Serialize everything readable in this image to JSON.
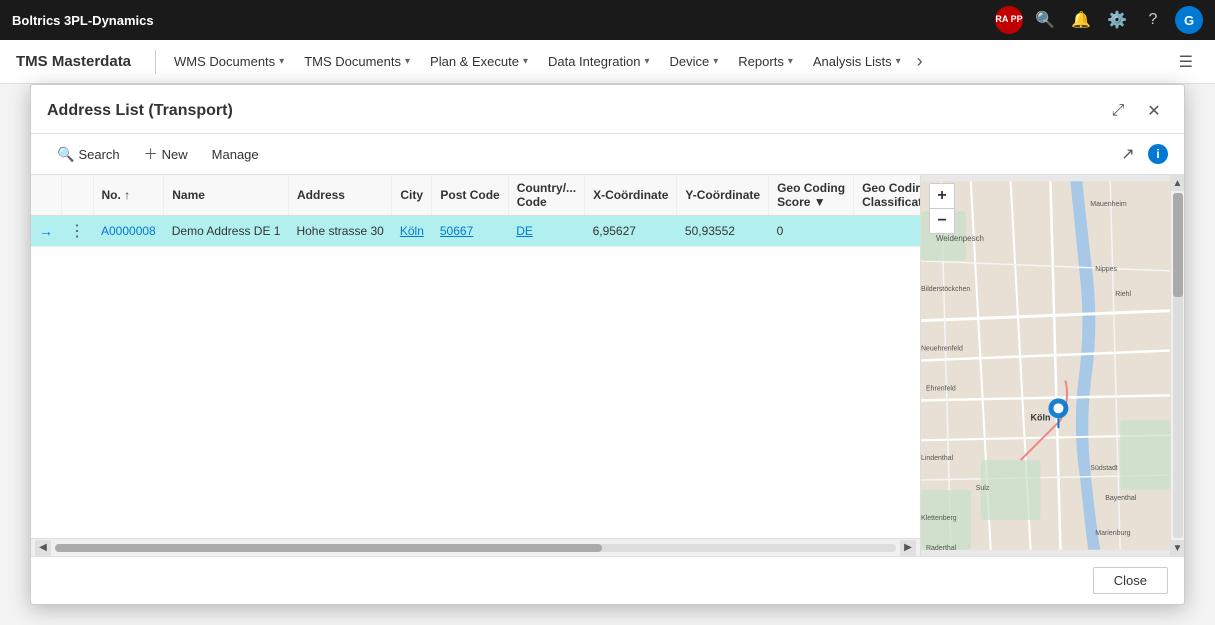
{
  "app": {
    "title": "Boltrics 3PL-Dynamics",
    "avatar_badge": "RA PP",
    "user_initial": "G"
  },
  "second_bar": {
    "title": "TMS Masterdata",
    "nav_items": [
      {
        "label": "WMS Documents",
        "has_chevron": true
      },
      {
        "label": "TMS Documents",
        "has_chevron": true
      },
      {
        "label": "Plan & Execute",
        "has_chevron": true
      },
      {
        "label": "Data Integration",
        "has_chevron": true
      },
      {
        "label": "Device",
        "has_chevron": true
      },
      {
        "label": "Reports",
        "has_chevron": true
      },
      {
        "label": "Analysis Lists",
        "has_chevron": true
      }
    ]
  },
  "modal": {
    "title": "Address List (Transport)",
    "toolbar": {
      "search_label": "Search",
      "new_label": "New",
      "manage_label": "Manage"
    },
    "table": {
      "columns": [
        {
          "label": "No. ↑",
          "key": "no",
          "sortable": true
        },
        {
          "label": "Name",
          "key": "name"
        },
        {
          "label": "Address",
          "key": "address"
        },
        {
          "label": "City",
          "key": "city"
        },
        {
          "label": "Post Code",
          "key": "post_code"
        },
        {
          "label": "Country/... Code",
          "key": "country_code"
        },
        {
          "label": "X-Coördinate",
          "key": "x_coord"
        },
        {
          "label": "Y-Coördinate",
          "key": "y_coord"
        },
        {
          "label": "Geo Coding Score ▼",
          "key": "geo_score",
          "sortable": true
        },
        {
          "label": "Geo Codir Classificat",
          "key": "geo_class"
        }
      ],
      "rows": [
        {
          "no": "A0000008",
          "name": "Demo Address DE 1",
          "address": "Hohe strasse 30",
          "city": "Köln",
          "post_code": "50667",
          "country_code": "DE",
          "x_coord": "6,95627",
          "y_coord": "50,93552",
          "geo_score": "0",
          "geo_class": "",
          "selected": true
        }
      ]
    },
    "close_button": "Close"
  }
}
